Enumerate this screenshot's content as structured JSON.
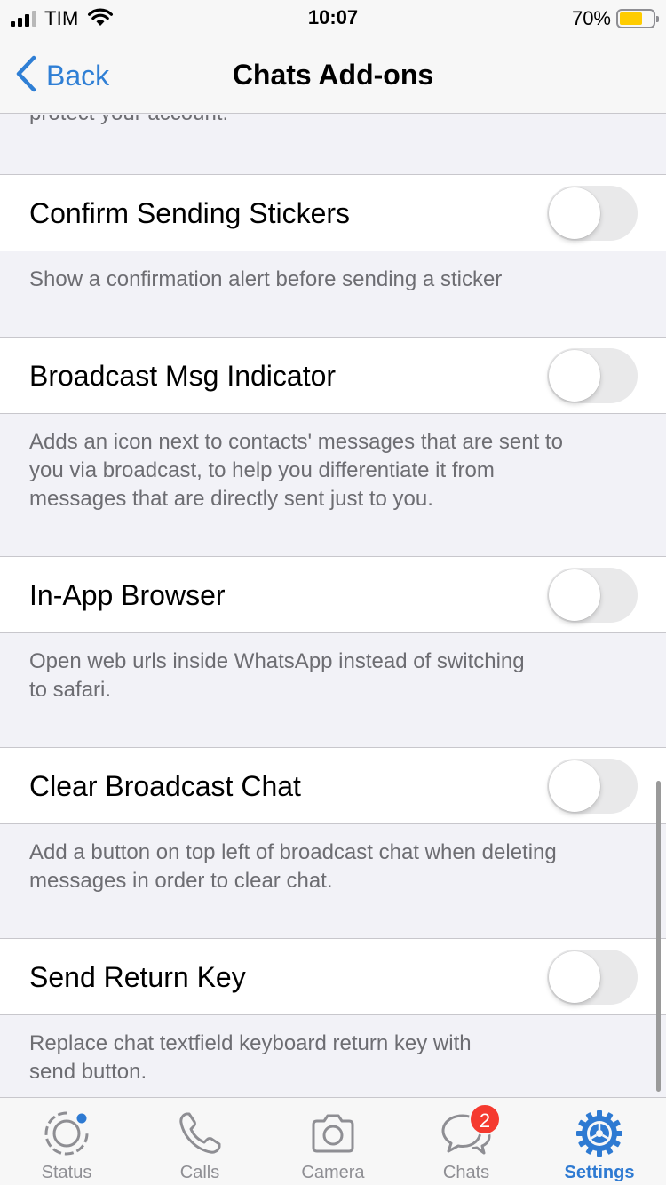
{
  "status_bar": {
    "carrier": "TIM",
    "time": "10:07",
    "battery_percent": "70%",
    "battery_level": 0.7,
    "battery_color": "#ffcc00"
  },
  "nav": {
    "back_label": "Back",
    "title": "Chats Add-ons",
    "accent_color": "#2f7fd5"
  },
  "top_note": "protect your account.",
  "settings": [
    {
      "label": "Confirm Sending Stickers",
      "enabled": false,
      "description_lines": [
        "Show a confirmation alert before sending a sticker"
      ]
    },
    {
      "label": "Broadcast Msg Indicator",
      "enabled": false,
      "description_lines": [
        "Adds an icon next to contacts' messages that are sent to",
        "you via broadcast, to help you differentiate it from",
        "messages that are directly sent just to you."
      ]
    },
    {
      "label": "In-App Browser",
      "enabled": false,
      "description_lines": [
        "Open web urls inside WhatsApp instead of switching",
        "to safari."
      ]
    },
    {
      "label": "Clear Broadcast Chat",
      "enabled": false,
      "description_lines": [
        "Add a button on top left of broadcast chat when deleting",
        "messages in order to clear chat."
      ]
    },
    {
      "label": "Send Return Key",
      "enabled": false,
      "description_lines": [
        "Replace chat textfield keyboard return key with",
        "send button."
      ]
    }
  ],
  "tab_bar": {
    "tabs": [
      {
        "label": "Status",
        "icon": "status-icon",
        "active": false
      },
      {
        "label": "Calls",
        "icon": "phone-icon",
        "active": false
      },
      {
        "label": "Camera",
        "icon": "camera-icon",
        "active": false
      },
      {
        "label": "Chats",
        "icon": "chat-bubbles-icon",
        "active": false,
        "badge": "2"
      },
      {
        "label": "Settings",
        "icon": "gear-icon",
        "active": true
      }
    ],
    "active_color": "#2e7ad2",
    "badge_color": "#f53a2f"
  }
}
